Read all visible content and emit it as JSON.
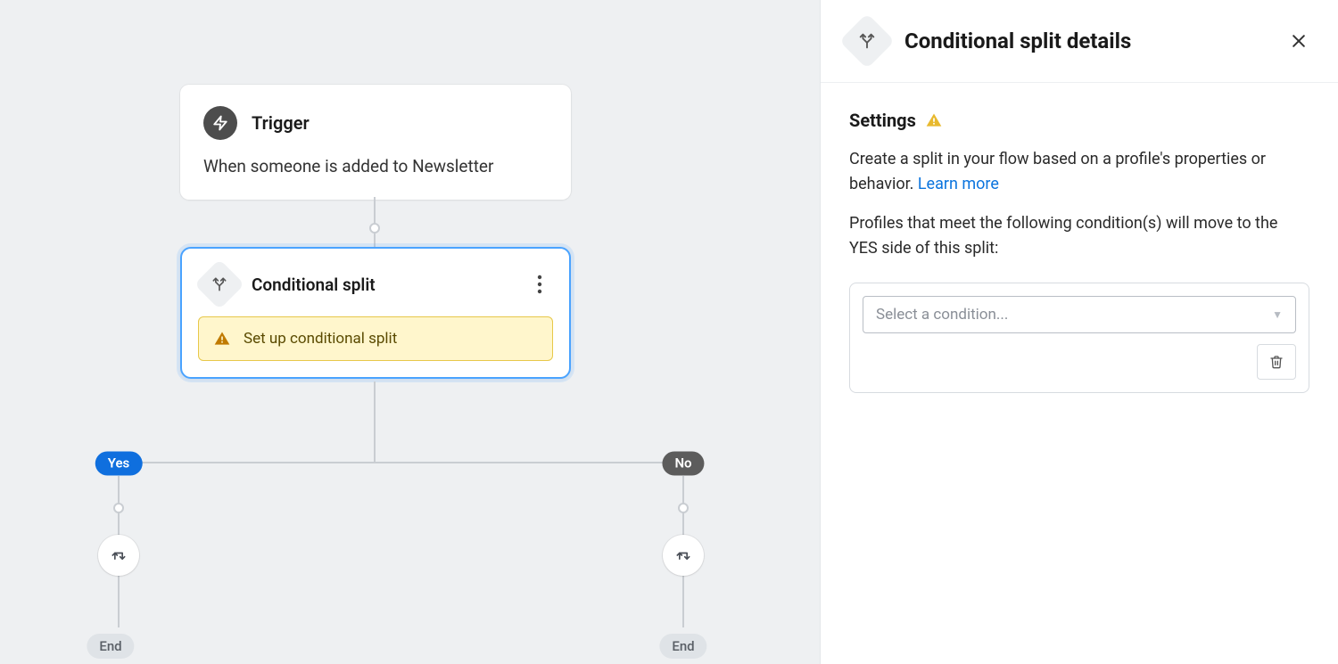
{
  "canvas": {
    "trigger": {
      "title": "Trigger",
      "subtitle": "When someone is added to Newsletter"
    },
    "split": {
      "title": "Conditional split",
      "warning": "Set up conditional split"
    },
    "branches": {
      "yes_label": "Yes",
      "no_label": "No",
      "end_label": "End"
    }
  },
  "sidebar": {
    "title": "Conditional split details",
    "settings_label": "Settings",
    "description": "Create a split in your flow based on a profile's properties or behavior. ",
    "learn_more": "Learn more",
    "condition_intro": "Profiles that meet the following condition(s) will move to the YES side of this split:",
    "select_placeholder": "Select a condition..."
  }
}
